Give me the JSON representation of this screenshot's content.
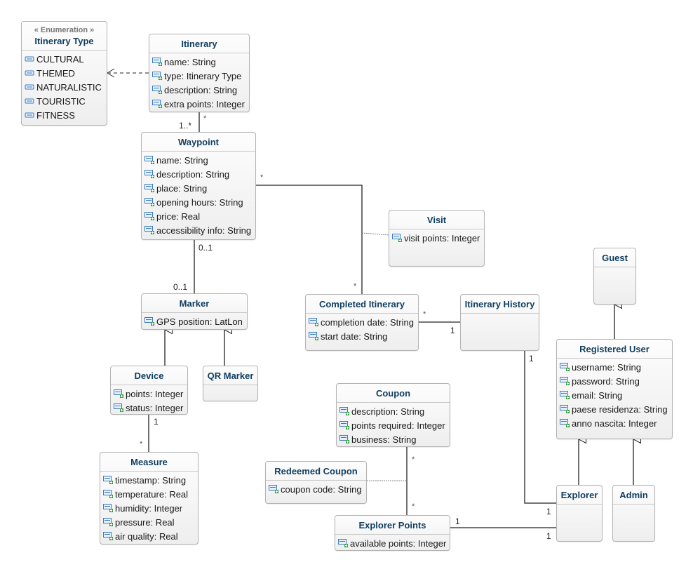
{
  "diagram": {
    "type": "UML class diagram",
    "classes": {
      "itinerary_type": {
        "stereotype": "« Enumeration »",
        "name": "Itinerary Type",
        "literals": [
          "CULTURAL",
          "THEMED",
          "NATURALISTIC",
          "TOURISTIC",
          "FITNESS"
        ]
      },
      "itinerary": {
        "name": "Itinerary",
        "attributes": [
          "name: String",
          "type: Itinerary Type",
          "description: String",
          "extra points: Integer"
        ]
      },
      "waypoint": {
        "name": "Waypoint",
        "attributes": [
          "name: String",
          "description: String",
          "place: String",
          "opening hours: String",
          "price: Real",
          "accessibility info: String"
        ]
      },
      "marker": {
        "name": "Marker",
        "attributes": [
          "GPS position: LatLon"
        ]
      },
      "device": {
        "name": "Device",
        "attributes": [
          "points: Integer",
          "status: Integer"
        ]
      },
      "qr_marker": {
        "name": "QR Marker",
        "attributes": []
      },
      "measure": {
        "name": "Measure",
        "attributes": [
          "timestamp: String",
          "temperature: Real",
          "humidity: Integer",
          "pressure: Real",
          "air quality: Real"
        ]
      },
      "visit": {
        "name": "Visit",
        "attributes": [
          "visit points: Integer"
        ]
      },
      "completed_itinerary": {
        "name": "Completed Itinerary",
        "attributes": [
          "completion date: String",
          "start date: String"
        ]
      },
      "itinerary_history": {
        "name": "Itinerary History",
        "attributes": []
      },
      "guest": {
        "name": "Guest",
        "attributes": []
      },
      "registered_user": {
        "name": "Registered User",
        "attributes": [
          "username: String",
          "password: String",
          "email: String",
          "paese residenza: String",
          "anno nascita: Integer"
        ]
      },
      "coupon": {
        "name": "Coupon",
        "attributes": [
          "description: String",
          "points required: Integer",
          "business: String"
        ]
      },
      "redeemed_coupon": {
        "name": "Redeemed Coupon",
        "attributes": [
          "coupon code: String"
        ]
      },
      "explorer_points": {
        "name": "Explorer Points",
        "attributes": [
          "available points: Integer"
        ]
      },
      "explorer": {
        "name": "Explorer",
        "attributes": []
      },
      "admin": {
        "name": "Admin",
        "attributes": []
      }
    },
    "multiplicities": {
      "itinerary_waypoint_itinerary_end": "*",
      "itinerary_waypoint_waypoint_end": "1..*",
      "waypoint_completed_waypoint_end": "*",
      "waypoint_completed_completed_end": "*",
      "waypoint_marker_waypoint_end": "0..1",
      "waypoint_marker_marker_end": "0..1",
      "device_measure_device_end": "1",
      "device_measure_measure_end": "*",
      "completed_history_completed_end": "*",
      "completed_history_history_end": "1",
      "history_explorer_history_end": "1",
      "history_explorer_explorer_end": "1",
      "coupon_points_coupon_end": "*",
      "coupon_points_points_end": "*",
      "points_explorer_points_end": "1",
      "points_explorer_explorer_end": "1"
    },
    "relationships": [
      {
        "kind": "dependency",
        "from": "Itinerary",
        "to": "Itinerary Type"
      },
      {
        "kind": "association",
        "from": "Itinerary",
        "to": "Waypoint"
      },
      {
        "kind": "association",
        "from": "Waypoint",
        "to": "Completed Itinerary",
        "association_class": "Visit"
      },
      {
        "kind": "association",
        "from": "Waypoint",
        "to": "Marker"
      },
      {
        "kind": "generalization",
        "from": "Device",
        "to": "Marker"
      },
      {
        "kind": "generalization",
        "from": "QR Marker",
        "to": "Marker"
      },
      {
        "kind": "association",
        "from": "Device",
        "to": "Measure"
      },
      {
        "kind": "association",
        "from": "Completed Itinerary",
        "to": "Itinerary History"
      },
      {
        "kind": "association",
        "from": "Itinerary History",
        "to": "Explorer"
      },
      {
        "kind": "generalization",
        "from": "Registered User",
        "to": "Guest"
      },
      {
        "kind": "generalization",
        "from": "Explorer",
        "to": "Registered User"
      },
      {
        "kind": "generalization",
        "from": "Admin",
        "to": "Registered User"
      },
      {
        "kind": "association",
        "from": "Coupon",
        "to": "Explorer Points",
        "association_class": "Redeemed Coupon"
      },
      {
        "kind": "association",
        "from": "Explorer Points",
        "to": "Explorer"
      }
    ],
    "colors": {
      "class_title": "#0f3d5f",
      "class_border": "#b3b3b3",
      "attribute_icon_blue": "#3b7bbf",
      "attribute_icon_green": "#2e9a3e"
    }
  }
}
